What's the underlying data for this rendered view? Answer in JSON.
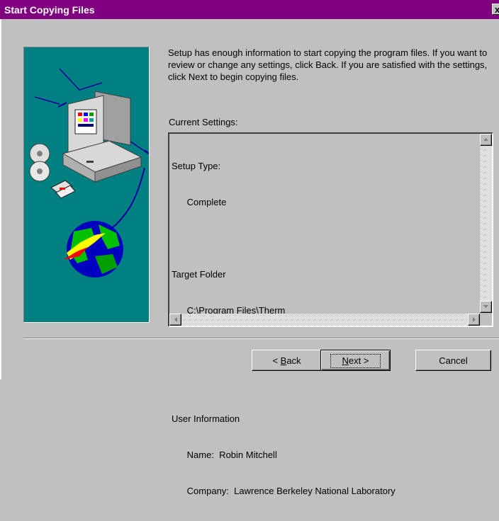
{
  "window": {
    "title": "Start Copying Files",
    "close_glyph": "x"
  },
  "intro_text": "Setup has enough information to start copying the program files. If you want to review or change any settings, click Back.  If you are satisfied with the settings, click Next to begin copying files.",
  "current_settings": {
    "label": "Current Settings:",
    "lines": [
      "Setup Type:",
      "      Complete",
      "",
      "Target Folder",
      "      C:\\Program Files\\Therm",
      "",
      "",
      "User Information",
      "      Name:  Robin Mitchell",
      "      Company:  Lawrence Berkeley National Laboratory"
    ]
  },
  "buttons": {
    "back": {
      "prefix": "< ",
      "mnemonic": "B",
      "rest": "ack"
    },
    "next": {
      "mnemonic": "N",
      "rest": "ext >"
    },
    "cancel": "Cancel"
  },
  "icons": [
    "close-icon",
    "computer-icon",
    "cd-icon",
    "floppy-disk-icon",
    "globe-icon",
    "scroll-arrow-icon"
  ],
  "colors": {
    "title_bar": "#800080",
    "panel": "#008080",
    "face": "#c0c0c0"
  }
}
